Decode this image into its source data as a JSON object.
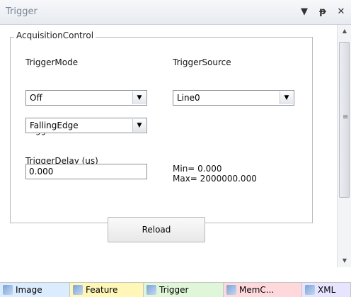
{
  "window": {
    "title": "Trigger",
    "icons": [
      "dropdown-menu-icon",
      "pin-icon",
      "close-icon"
    ],
    "icon_glyphs": [
      "▼",
      "ᵽ",
      "✕"
    ]
  },
  "group": {
    "title": "AcquisitionControl",
    "trigger_mode": {
      "label": "TriggerMode",
      "value": "Off"
    },
    "trigger_source": {
      "label": "TriggerSource",
      "value": "Line0"
    },
    "trigger_activation": {
      "label": "TriggerActivation",
      "value": "FallingEdge"
    },
    "trigger_delay": {
      "label": "TriggerDelay (us)",
      "value": "0.000"
    },
    "min": "Min= 0.000",
    "max": "Max= 2000000.000"
  },
  "reload_label": "Reload",
  "tabs": [
    {
      "label": "Image",
      "color": "#dcecff"
    },
    {
      "label": "Feature",
      "color": "#fff7b8"
    },
    {
      "label": "Trigger",
      "color": "#e0f6d8"
    },
    {
      "label": "MemC...",
      "color": "#ffd8dc"
    },
    {
      "label": "XML",
      "color": "#e7e4ff"
    }
  ]
}
